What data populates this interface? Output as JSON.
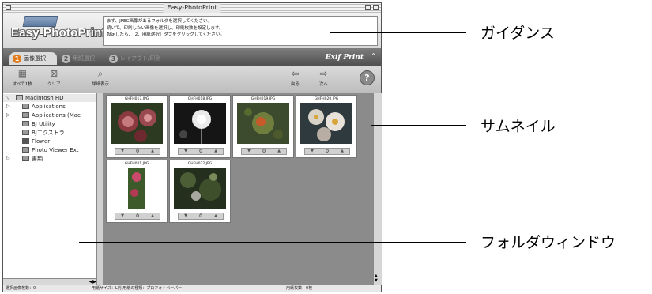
{
  "window": {
    "title": "Easy-PhotoPrint",
    "logo": "Easy-PhotoPrint"
  },
  "guidance_text": [
    "まず、JPEG画像があるフォルダを選択してください。",
    "続いて、印刷したい画像を選択し、印刷枚数を設定します。",
    "設定したら、［2．用紙選択］タブをクリックしてください。"
  ],
  "tabs": [
    {
      "num": "1",
      "label": "画像選択"
    },
    {
      "num": "2",
      "label": "用紙選択"
    },
    {
      "num": "3",
      "label": "レイアウト/印刷"
    }
  ],
  "exif_logo": "Exif Print",
  "toolbar": {
    "select_all": "すべて1枚",
    "clear": "クリア",
    "details": "詳細表示",
    "back": "戻る",
    "next": "次へ",
    "help": "?"
  },
  "tree": [
    {
      "label": "Macintosh HD",
      "expanded": true
    },
    {
      "label": "Applications"
    },
    {
      "label": "Applications (Mac"
    },
    {
      "label": "BJ Utility"
    },
    {
      "label": "BJエクストラ"
    },
    {
      "label": "Flower"
    },
    {
      "label": "Photo Viewer Ext"
    },
    {
      "label": "書類"
    }
  ],
  "thumbnails": [
    {
      "filename": "GHFH017.JPG",
      "count": "0"
    },
    {
      "filename": "GHFH018.JPG",
      "count": "0"
    },
    {
      "filename": "GHFH019.JPG",
      "count": "0"
    },
    {
      "filename": "GHFH020.JPG",
      "count": "0"
    },
    {
      "filename": "GHFH021.JPG",
      "count": "0"
    },
    {
      "filename": "GHFH022.JPG",
      "count": "0"
    }
  ],
  "status": {
    "selected": "選択画像枚数：0",
    "paper": "用紙サイズ：L判 用紙の種類：プロフォトペーパー",
    "sheets": "用紙枚数：0枚"
  },
  "callouts": {
    "guidance": "ガイダンス",
    "thumbnail": "サムネイル",
    "folder_window": "フォルダウィンドウ"
  }
}
